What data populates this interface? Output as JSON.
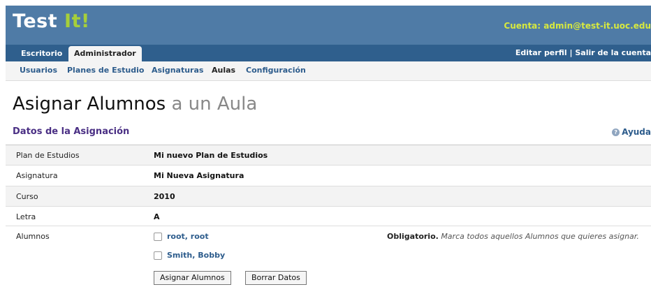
{
  "header": {
    "logo_main": "Test",
    "logo_accent": "It!",
    "account_label": "Cuenta:",
    "account_email": "admin@test-it.uoc.edu"
  },
  "tabs": [
    {
      "label": "Escritorio",
      "active": false
    },
    {
      "label": "Administrador",
      "active": true
    }
  ],
  "tab_links": {
    "edit_profile": "Editar perfil",
    "separator": "|",
    "logout": "Salir de la cuenta"
  },
  "subnav": [
    {
      "label": "Usuarios",
      "current": false
    },
    {
      "label": "Planes de Estudio",
      "current": false
    },
    {
      "label": "Asignaturas",
      "current": false
    },
    {
      "label": "Aulas",
      "current": true
    },
    {
      "label": "Configuración",
      "current": false
    }
  ],
  "page": {
    "title_main": "Asignar Alumnos",
    "title_rest": "a un Aula",
    "section_title": "Datos de la Asignación",
    "help_label": "Ayuda"
  },
  "form": {
    "rows": [
      {
        "label": "Plan de Estudios",
        "value": "Mi nuevo Plan de Estudios"
      },
      {
        "label": "Asignatura",
        "value": "Mi Nueva Asignatura"
      },
      {
        "label": "Curso",
        "value": "2010"
      },
      {
        "label": "Letra",
        "value": "A"
      }
    ],
    "students_label": "Alumnos",
    "students": [
      {
        "name": "root, root",
        "checked": false
      },
      {
        "name": "Smith, Bobby",
        "checked": false
      }
    ],
    "note_required": "Obligatorio.",
    "note_text": "Marca todos aquellos Alumnos que quieres asignar.",
    "submit_label": "Asignar Alumnos",
    "reset_label": "Borrar Datos"
  },
  "colors": {
    "header_bg": "#4f7ba6",
    "tabs_bg": "#2f5f8d",
    "logo_accent": "#a6cf3a",
    "account_text": "#d7e93f",
    "link": "#2d5c8c",
    "section_title": "#4a2f84"
  }
}
